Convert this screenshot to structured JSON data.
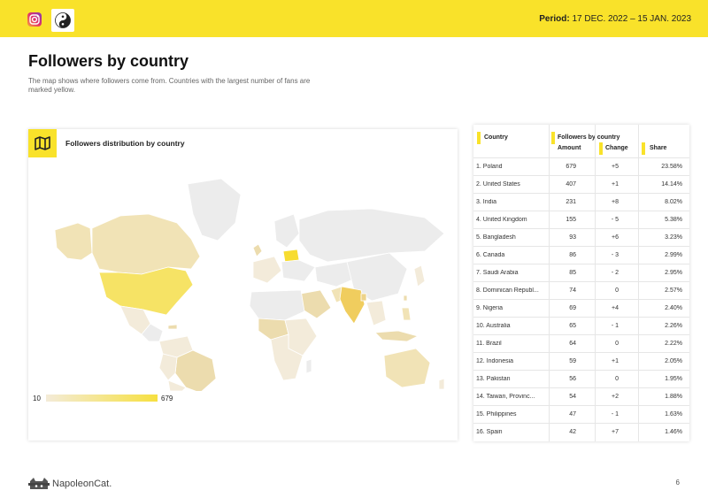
{
  "header": {
    "period_label": "Period:",
    "period_value": "17 DEC. 2022 – 15 JAN. 2023",
    "icons": [
      "instagram-icon",
      "yin-yang-logo-icon"
    ],
    "accent_color": "#f9e22a"
  },
  "page": {
    "title": "Followers by country",
    "description": "The map shows where followers come from. Countries with the largest number of fans are marked yellow."
  },
  "map": {
    "title": "Followers distribution by country",
    "icon": "map-icon",
    "legend_min": "10",
    "legend_max": "679",
    "colors": {
      "low": "#f4ebd8",
      "high": "#f6e040",
      "no_data": "#ececec"
    }
  },
  "table": {
    "col_country": "Country",
    "col_group": "Followers by country",
    "col_amount": "Amount",
    "col_change": "Change",
    "col_share": "Share",
    "rows": [
      {
        "country": "1. Poland",
        "amount": "679",
        "change": "+5",
        "share": "23.58%"
      },
      {
        "country": "2. United States",
        "amount": "407",
        "change": "+1",
        "share": "14.14%"
      },
      {
        "country": "3. India",
        "amount": "231",
        "change": "+8",
        "share": "8.02%"
      },
      {
        "country": "4. United Kingdom",
        "amount": "155",
        "change": "- 5",
        "share": "5.38%"
      },
      {
        "country": "5. Bangladesh",
        "amount": "93",
        "change": "+6",
        "share": "3.23%"
      },
      {
        "country": "6. Canada",
        "amount": "86",
        "change": "- 3",
        "share": "2.99%"
      },
      {
        "country": "7. Saudi Arabia",
        "amount": "85",
        "change": "- 2",
        "share": "2.95%"
      },
      {
        "country": "8. Dominican Republ...",
        "amount": "74",
        "change": "0",
        "share": "2.57%"
      },
      {
        "country": "9. Nigeria",
        "amount": "69",
        "change": "+4",
        "share": "2.40%"
      },
      {
        "country": "10. Australia",
        "amount": "65",
        "change": "- 1",
        "share": "2.26%"
      },
      {
        "country": "11. Brazil",
        "amount": "64",
        "change": "0",
        "share": "2.22%"
      },
      {
        "country": "12. Indonesia",
        "amount": "59",
        "change": "+1",
        "share": "2.05%"
      },
      {
        "country": "13. Pakistan",
        "amount": "56",
        "change": "0",
        "share": "1.95%"
      },
      {
        "country": "14. Taiwan, Provinc...",
        "amount": "54",
        "change": "+2",
        "share": "1.88%"
      },
      {
        "country": "15. Philippines",
        "amount": "47",
        "change": "- 1",
        "share": "1.63%"
      },
      {
        "country": "16. Spain",
        "amount": "42",
        "change": "+7",
        "share": "1.46%"
      }
    ]
  },
  "footer": {
    "brand": "NapoleonCat.",
    "page_number": "6",
    "logo_icon": "napoleoncat-logo-icon"
  }
}
